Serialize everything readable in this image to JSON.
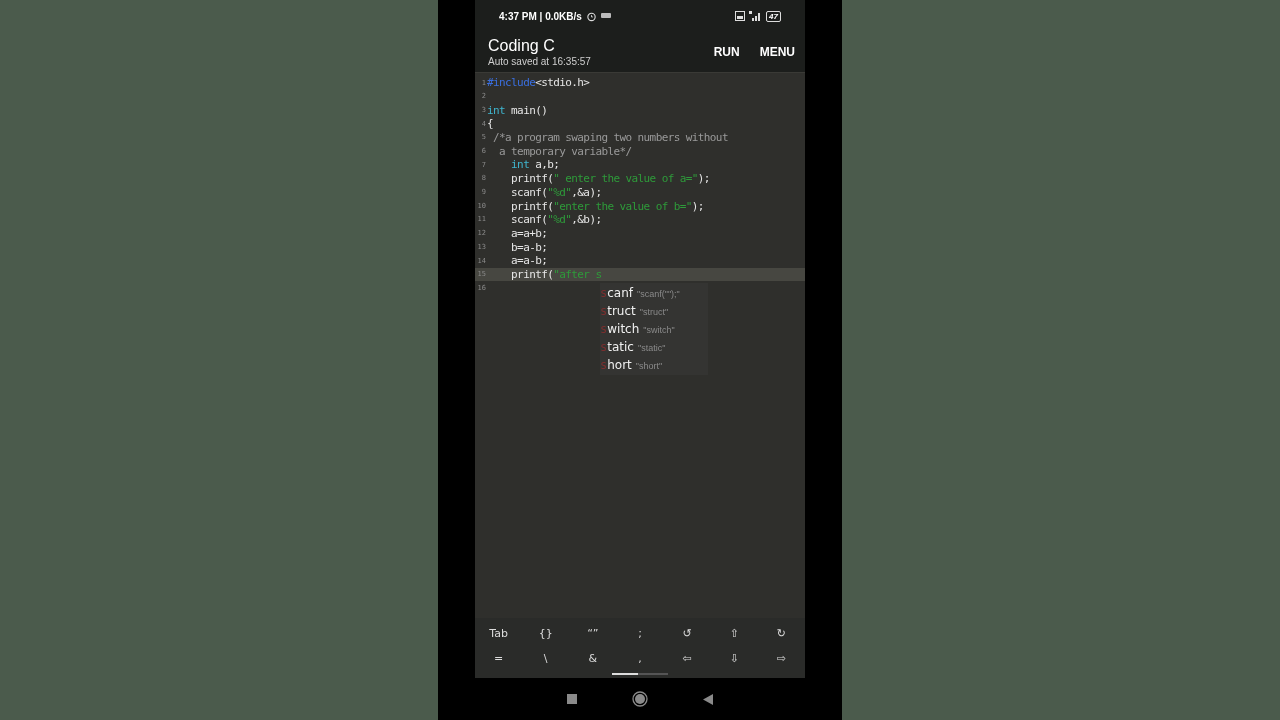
{
  "status_bar": {
    "left": "4:37 PM | 0.0KB/s",
    "battery": "47"
  },
  "app_bar": {
    "title": "Coding C",
    "subtitle": "Auto saved at 16:35:57",
    "actions": [
      "RUN",
      "MENU"
    ]
  },
  "editor": {
    "lines": [
      {
        "number": "1",
        "current": false,
        "tokens": [
          {
            "kind": "directive",
            "text": "#include"
          },
          {
            "kind": "plain",
            "text": "<stdio.h>"
          }
        ]
      },
      {
        "number": "2",
        "current": false
      },
      {
        "number": "3",
        "current": false,
        "tokens": [
          {
            "kind": "keyword",
            "text": "int"
          },
          {
            "kind": "plain",
            "text": " main()"
          }
        ]
      },
      {
        "number": "4",
        "current": false,
        "tokens": [
          {
            "kind": "plain",
            "text": "{"
          }
        ]
      },
      {
        "number": "5",
        "current": false,
        "tokens": [
          {
            "kind": "comment",
            "text": " /*a program swaping two numbers without"
          }
        ]
      },
      {
        "number": "6",
        "current": false,
        "tokens": [
          {
            "kind": "comment",
            "text": "  a temporary variable*/"
          }
        ]
      },
      {
        "number": "7",
        "current": false,
        "tokens": [
          {
            "kind": "keyword",
            "text": "    int"
          },
          {
            "kind": "plain",
            "text": " a,b;"
          }
        ]
      },
      {
        "number": "8",
        "current": false,
        "tokens": [
          {
            "kind": "plain",
            "text": "    printf("
          },
          {
            "kind": "string",
            "text": "\" enter the value of a=\""
          },
          {
            "kind": "plain",
            "text": ");"
          }
        ]
      },
      {
        "number": "9",
        "current": false,
        "tokens": [
          {
            "kind": "plain",
            "text": "    scanf("
          },
          {
            "kind": "string",
            "text": "\"%d\""
          },
          {
            "kind": "plain",
            "text": ",&a);"
          }
        ]
      },
      {
        "number": "10",
        "current": false,
        "tokens": [
          {
            "kind": "plain",
            "text": "    printf("
          },
          {
            "kind": "string",
            "text": "\"enter the value of b=\""
          },
          {
            "kind": "plain",
            "text": ");"
          }
        ]
      },
      {
        "number": "11",
        "current": false,
        "tokens": [
          {
            "kind": "plain",
            "text": "    scanf("
          },
          {
            "kind": "string",
            "text": "\"%d\""
          },
          {
            "kind": "plain",
            "text": ",&b);"
          }
        ]
      },
      {
        "number": "12",
        "current": false,
        "tokens": [
          {
            "kind": "plain",
            "text": "    a=a+b;"
          }
        ]
      },
      {
        "number": "13",
        "current": false,
        "tokens": [
          {
            "kind": "plain",
            "text": "    b=a-b;"
          }
        ]
      },
      {
        "number": "14",
        "current": false,
        "tokens": [
          {
            "kind": "plain",
            "text": "    a=a-b;"
          }
        ]
      },
      {
        "number": "15",
        "current": true,
        "tokens": [
          {
            "kind": "plain",
            "text": "    printf("
          },
          {
            "kind": "string",
            "text": "\"after s"
          }
        ]
      },
      {
        "number": "16",
        "current": false
      }
    ],
    "suggestions": [
      {
        "prefix": "s",
        "rest": "canf",
        "hint": "\"scanf(\"\");\""
      },
      {
        "prefix": "s",
        "rest": "truct",
        "hint": "\"struct\""
      },
      {
        "prefix": "s",
        "rest": "witch",
        "hint": "\"switch\""
      },
      {
        "prefix": "s",
        "rest": "tatic",
        "hint": "\"static\""
      },
      {
        "prefix": "s",
        "rest": "hort",
        "hint": "\"short\""
      }
    ]
  },
  "keys": [
    [
      "Tab",
      "{}",
      "“”",
      ";",
      "↺",
      "⇧",
      "↻"
    ],
    [
      "=",
      "\\",
      "&",
      ",",
      "⇦",
      "⇩",
      "⇨"
    ]
  ]
}
